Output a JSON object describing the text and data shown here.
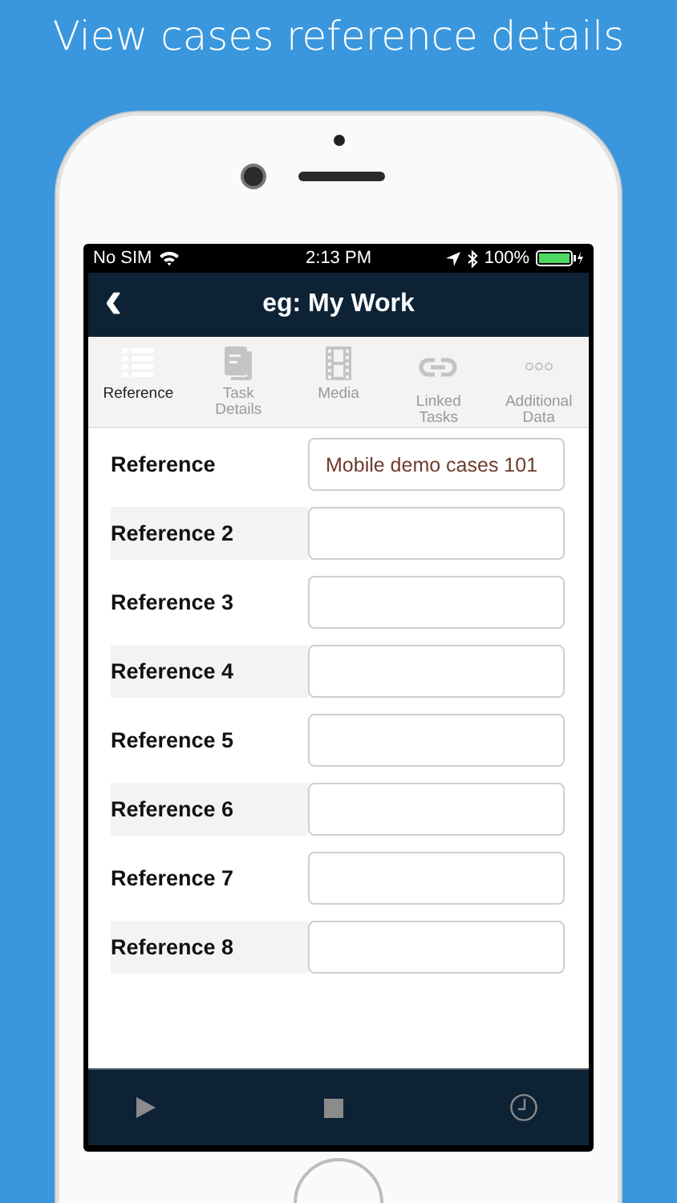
{
  "headline": "View cases reference details",
  "status_bar": {
    "carrier": "No SIM",
    "time": "2:13 PM",
    "battery": "100%"
  },
  "nav_bar": {
    "back": "‹",
    "title": "eg: My Work"
  },
  "tabs": [
    {
      "kind": "list",
      "label": "Reference",
      "selected": true
    },
    {
      "kind": "document",
      "label": "Task Details",
      "selected": false
    },
    {
      "kind": "film",
      "label": "Media",
      "selected": false
    },
    {
      "kind": "link",
      "label": "Linked Tasks",
      "selected": false
    },
    {
      "kind": "dots",
      "label": "Additional Data",
      "selected": false
    }
  ],
  "fields": [
    {
      "label": "Reference",
      "value": "Mobile demo cases 101"
    },
    {
      "label": "Reference 2"
    },
    {
      "label": "Reference 3"
    },
    {
      "label": "Reference 4"
    },
    {
      "label": "Reference 5"
    },
    {
      "label": "Reference 6"
    },
    {
      "label": "Reference 7"
    },
    {
      "label": "Reference 8"
    }
  ],
  "toolbar": [
    {
      "kind": "play"
    },
    {
      "kind": "stop"
    },
    {
      "kind": "clock"
    }
  ]
}
